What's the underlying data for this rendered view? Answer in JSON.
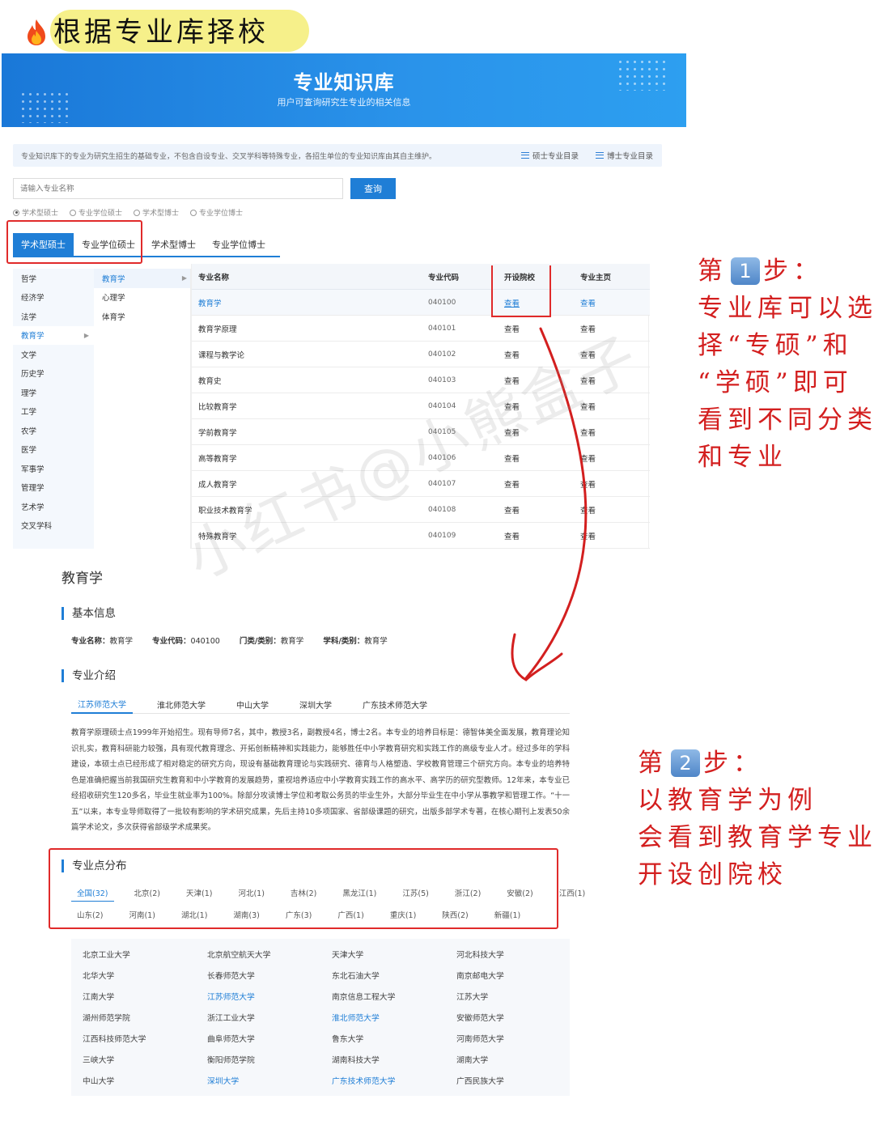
{
  "page_title": "根据专业库择校",
  "banner": {
    "title": "专业知识库",
    "subtitle": "用户可查询研究生专业的相关信息"
  },
  "info_bar": {
    "text": "专业知识库下的专业为研究生招生的基础专业，不包含自设专业、交叉学科等特殊专业，各招生单位的专业知识库由其自主维护。",
    "links": [
      "硕士专业目录",
      "博士专业目录"
    ]
  },
  "search": {
    "placeholder": "请输入专业名称",
    "button": "查询"
  },
  "radios": [
    {
      "label": "学术型硕士",
      "selected": true
    },
    {
      "label": "专业学位硕士",
      "selected": false
    },
    {
      "label": "学术型博士",
      "selected": false
    },
    {
      "label": "专业学位博士",
      "selected": false
    }
  ],
  "tabs": [
    {
      "label": "学术型硕士",
      "active": true
    },
    {
      "label": "专业学位硕士",
      "active": false
    },
    {
      "label": "学术型博士",
      "active": false
    },
    {
      "label": "专业学位博士",
      "active": false
    }
  ],
  "categories": [
    "哲学",
    "经济学",
    "法学",
    "教育学",
    "文学",
    "历史学",
    "理学",
    "工学",
    "农学",
    "医学",
    "军事学",
    "管理学",
    "艺术学",
    "交叉学科"
  ],
  "active_category": "教育学",
  "subcategories": [
    "教育学",
    "心理学",
    "体育学"
  ],
  "active_subcategory": "教育学",
  "table": {
    "headers": [
      "专业名称",
      "专业代码",
      "开设院校",
      "专业主页"
    ],
    "rows": [
      {
        "name": "教育学",
        "code": "040100",
        "school": "查看",
        "home": "查看"
      },
      {
        "name": "教育学原理",
        "code": "040101",
        "school": "查看",
        "home": "查看"
      },
      {
        "name": "课程与教学论",
        "code": "040102",
        "school": "查看",
        "home": "查看"
      },
      {
        "name": "教育史",
        "code": "040103",
        "school": "查看",
        "home": "查看"
      },
      {
        "name": "比较教育学",
        "code": "040104",
        "school": "查看",
        "home": "查看"
      },
      {
        "name": "学前教育学",
        "code": "040105",
        "school": "查看",
        "home": "查看"
      },
      {
        "name": "高等教育学",
        "code": "040106",
        "school": "查看",
        "home": "查看"
      },
      {
        "name": "成人教育学",
        "code": "040107",
        "school": "查看",
        "home": "查看"
      },
      {
        "name": "职业技术教育学",
        "code": "040108",
        "school": "查看",
        "home": "查看"
      },
      {
        "name": "特殊教育学",
        "code": "040109",
        "school": "查看",
        "home": "查看"
      }
    ]
  },
  "step1": {
    "prefix": "第",
    "num": "1",
    "suffix": "步：",
    "lines": [
      "专业库可以选",
      "择“专硕”和",
      "“学硕”即可",
      "看到不同分类",
      "和专业"
    ]
  },
  "step2": {
    "prefix": "第",
    "num": "2",
    "suffix": "步：",
    "lines": [
      "以教育学为例",
      "会看到教育学专业",
      "开设创院校"
    ]
  },
  "detail": {
    "title": "教育学",
    "basic_head": "基本信息",
    "basic": [
      {
        "k": "专业名称：",
        "v": "教育学"
      },
      {
        "k": "专业代码：",
        "v": "040100"
      },
      {
        "k": "门类/类别：",
        "v": "教育学"
      },
      {
        "k": "学科/类别：",
        "v": "教育学"
      }
    ],
    "intro_head": "专业介绍",
    "school_tabs": [
      "江苏师范大学",
      "淮北师范大学",
      "中山大学",
      "深圳大学",
      "广东技术师范大学"
    ],
    "intro": "教育学原理硕士点1999年开始招生。现有导师7名，其中，教授3名，副教授4名，博士2名。本专业的培养目标是：德智体美全面发展，教育理论知识扎实，教育科研能力较强，具有现代教育理念、开拓创新精神和实践能力，能够胜任中小学教育研究和实践工作的高级专业人才。经过多年的学科建设，本硕士点已经形成了相对稳定的研究方向，现设有基础教育理论与实践研究、德育与人格塑造、学校教育管理三个研究方向。本专业的培养特色是准确把握当前我国研究生教育和中小学教育的发展趋势，重视培养适应中小学教育实践工作的高水平、高学历的研究型教师。12年来，本专业已经招收研究生120多名，毕业生就业率为100%。除部分攻读博士学位和考取公务员的毕业生外，大部分毕业生在中小学从事教学和管理工作。“十一五”以来，本专业导师取得了一批较有影响的学术研究成果，先后主持10多项国家、省部级课题的研究，出版多部学术专著，在核心期刊上发表50余篇学术论文，多次获得省部级学术成果奖。",
    "dist_head": "专业点分布",
    "regions_row1": [
      "全国(32)",
      "北京(2)",
      "天津(1)",
      "河北(1)",
      "吉林(2)",
      "黑龙江(1)",
      "江苏(5)",
      "浙江(2)",
      "安徽(2)",
      "江西(1)"
    ],
    "regions_row2": [
      "山东(2)",
      "河南(1)",
      "湖北(1)",
      "湖南(3)",
      "广东(3)",
      "广西(1)",
      "重庆(1)",
      "陕西(2)",
      "新疆(1)"
    ],
    "universities": [
      [
        "北京工业大学",
        "北京航空航天大学",
        "天津大学",
        "河北科技大学"
      ],
      [
        "北华大学",
        "长春师范大学",
        "东北石油大学",
        "南京邮电大学"
      ],
      [
        "江南大学",
        "江苏师范大学",
        "南京信息工程大学",
        "江苏大学"
      ],
      [
        "湖州师范学院",
        "浙江工业大学",
        "淮北师范大学",
        "安徽师范大学"
      ],
      [
        "江西科技师范大学",
        "曲阜师范大学",
        "鲁东大学",
        "河南师范大学"
      ],
      [
        "三峡大学",
        "衡阳师范学院",
        "湖南科技大学",
        "湖南大学"
      ],
      [
        "中山大学",
        "深圳大学",
        "广东技术师范大学",
        "广西民族大学"
      ]
    ],
    "highlighted_universities": [
      "江苏师范大学",
      "淮北师范大学",
      "深圳大学",
      "广东技术师范大学"
    ]
  },
  "watermark": "小红书@小熊盒子",
  "colors": {
    "accent": "#1f7ed6",
    "annotation": "#d31f1f",
    "highlight": "#f6f08a"
  }
}
